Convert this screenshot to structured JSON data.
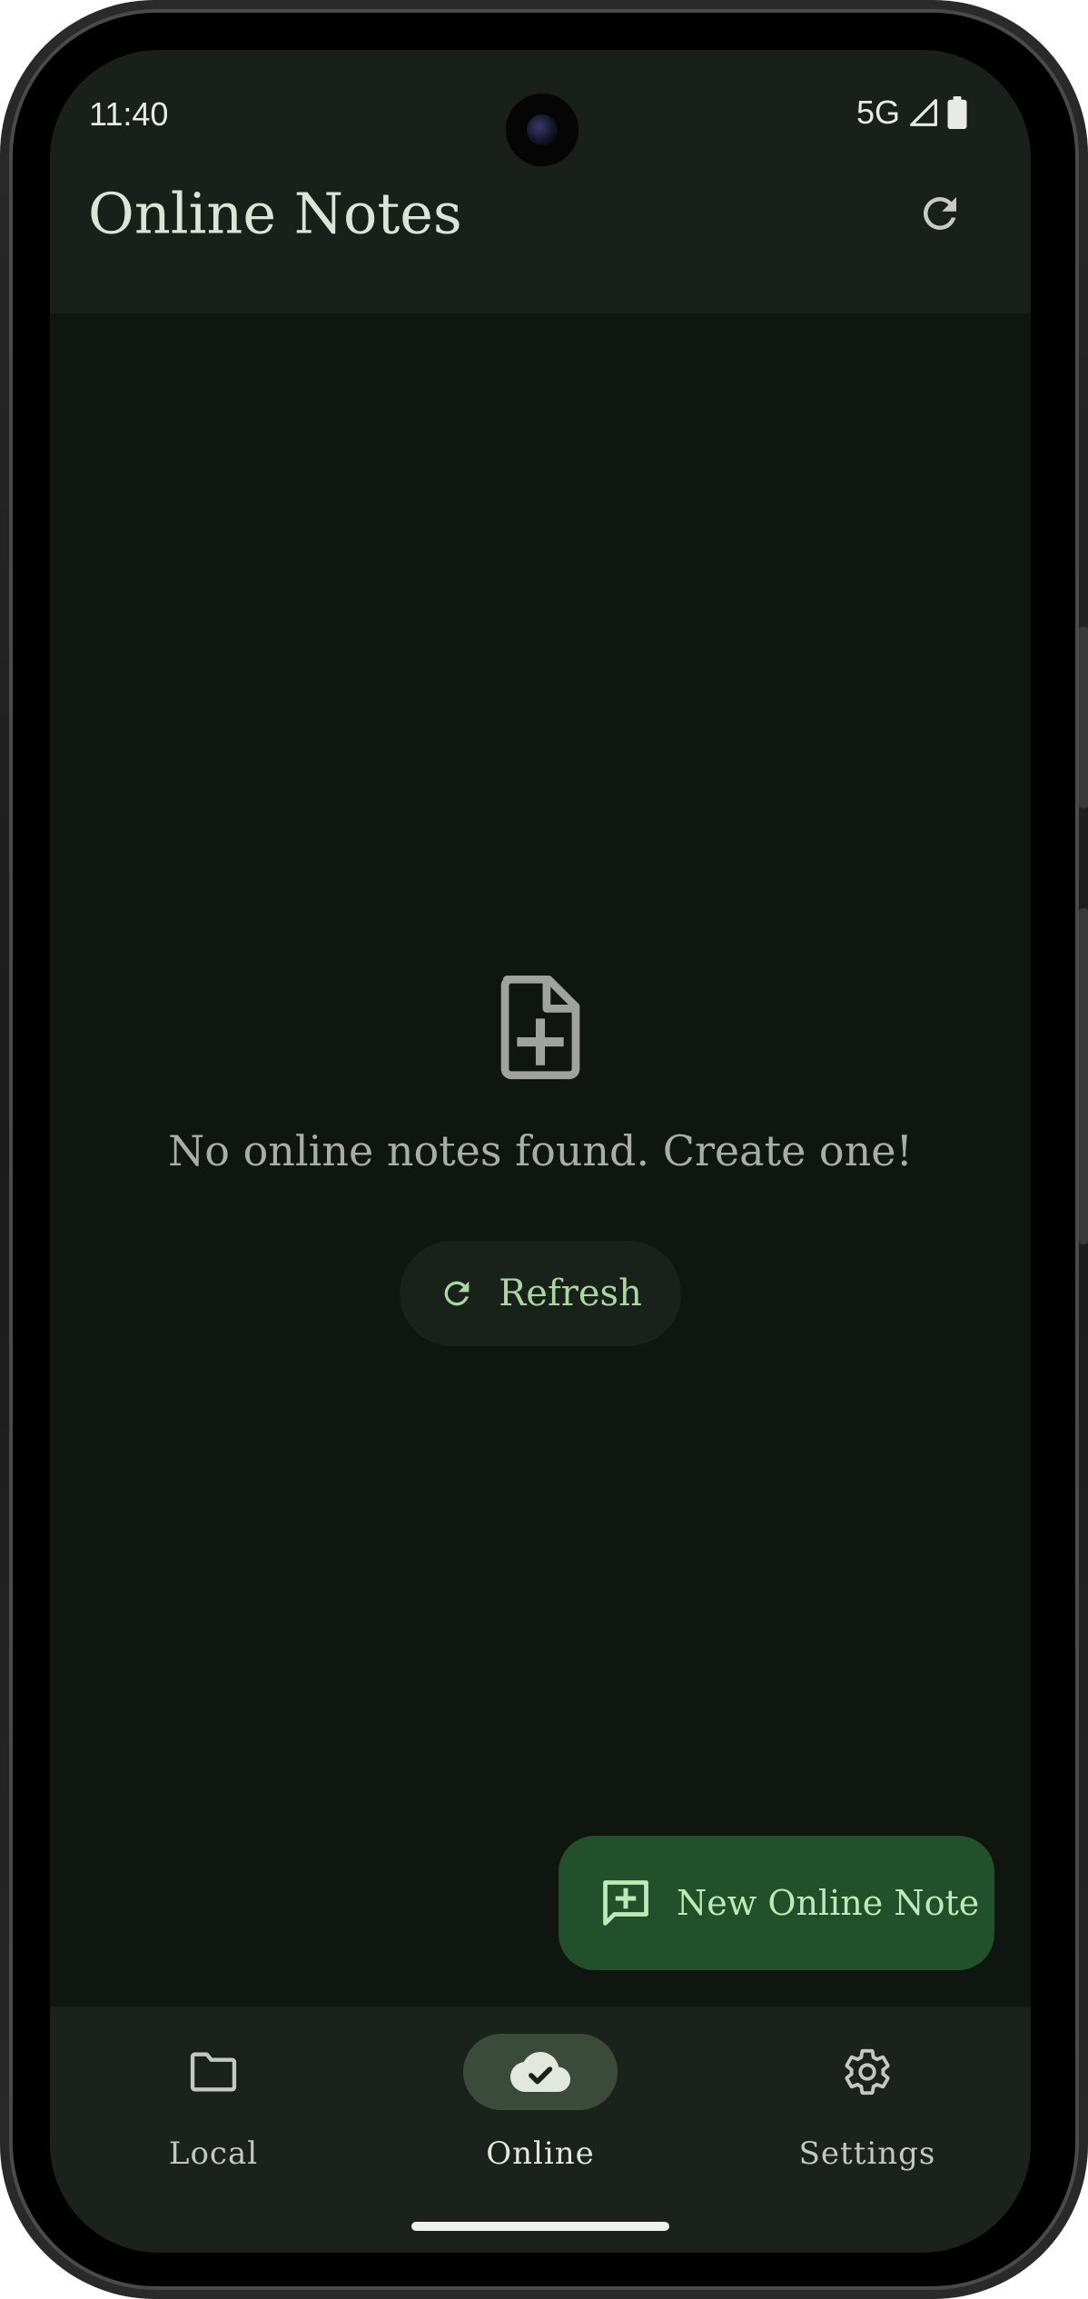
{
  "status_bar": {
    "time": "11:40",
    "network": "5G",
    "signal_icon": "signal-icon",
    "battery_icon": "battery-icon"
  },
  "app_bar": {
    "title": "Online Notes",
    "action_icon": "refresh-icon"
  },
  "empty_state": {
    "icon": "note-add-icon",
    "message": "No online notes found. Create one!",
    "refresh_label": "Refresh"
  },
  "fab": {
    "icon": "add-comment-icon",
    "label": "New Online Note"
  },
  "bottom_nav": {
    "items": [
      {
        "label": "Local",
        "icon": "folder-icon",
        "active": false
      },
      {
        "label": "Online",
        "icon": "cloud-done-icon",
        "active": true
      },
      {
        "label": "Settings",
        "icon": "gear-icon",
        "active": false
      }
    ]
  },
  "colors": {
    "background": "#0f150f",
    "surface": "#191f19",
    "primary": "#a6d89f",
    "fab_container": "#22502a",
    "nav_active_indicator": "#3a4c39"
  }
}
